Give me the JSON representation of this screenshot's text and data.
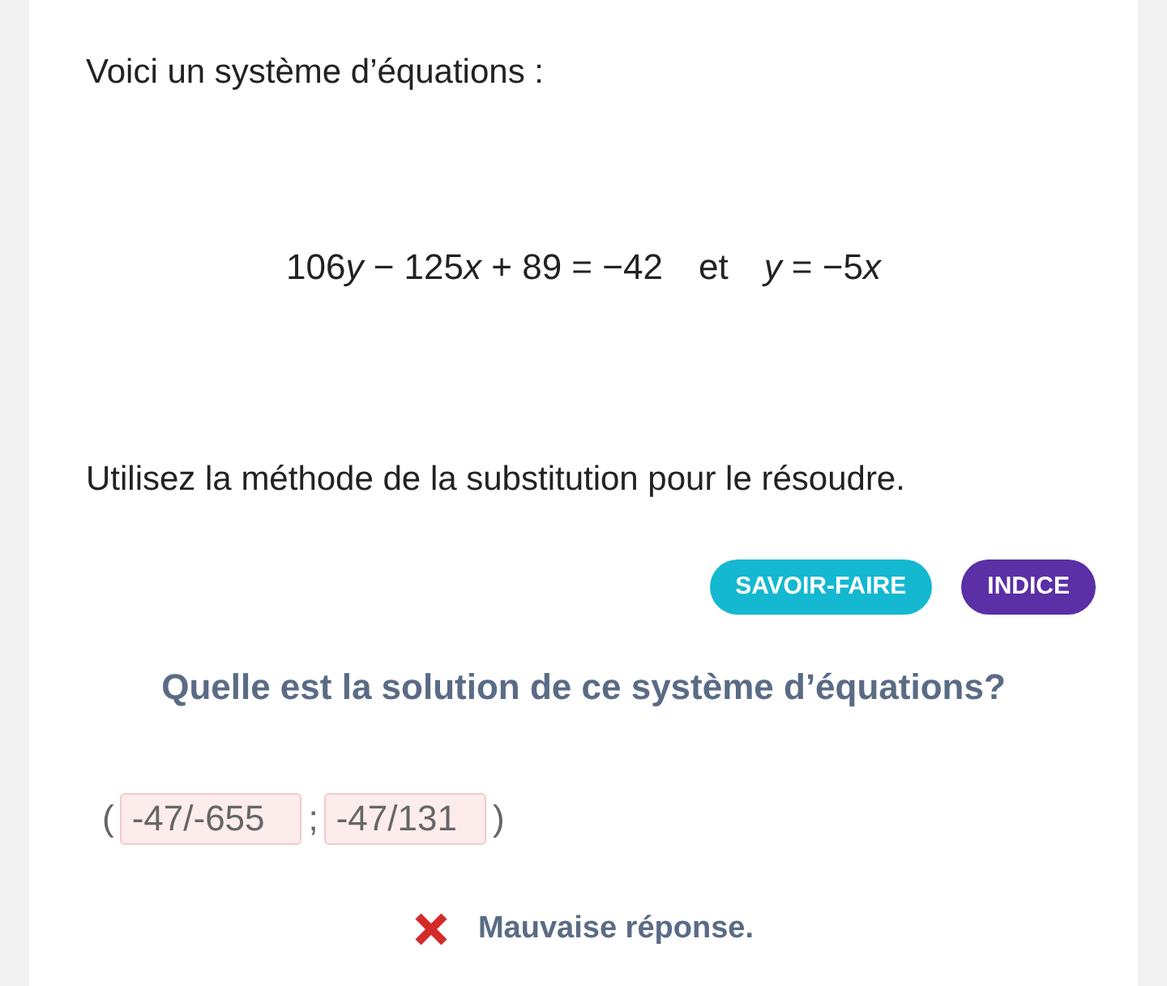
{
  "intro": "Voici un système d’équations :",
  "equation": [
    {
      "text": "106",
      "italic": false
    },
    {
      "text": "y",
      "italic": true
    },
    {
      "text": " − 125",
      "italic": false
    },
    {
      "text": "x",
      "italic": true
    },
    {
      "text": " + 89 = −42",
      "italic": false
    },
    {
      "text": "et",
      "italic": false
    },
    {
      "text": "y",
      "italic": true
    },
    {
      "text": " = −5",
      "italic": false
    },
    {
      "text": "x",
      "italic": true
    }
  ],
  "instruction": "Utilisez la méthode de la substitution pour le résoudre.",
  "buttons": [
    {
      "label": "SAVOIR-FAIRE",
      "kind": "howto"
    },
    {
      "label": "INDICE",
      "kind": "hint"
    }
  ],
  "question": "Quelle est la solution de ce système d’équations?",
  "answer": {
    "open": "(",
    "separator": ";",
    "close": ")",
    "fields": [
      {
        "value": "-47/-655",
        "correct": false
      },
      {
        "value": "-47/131",
        "correct": false
      }
    ]
  },
  "feedback": {
    "text": "Mauvaise réponse.",
    "correct": false
  }
}
